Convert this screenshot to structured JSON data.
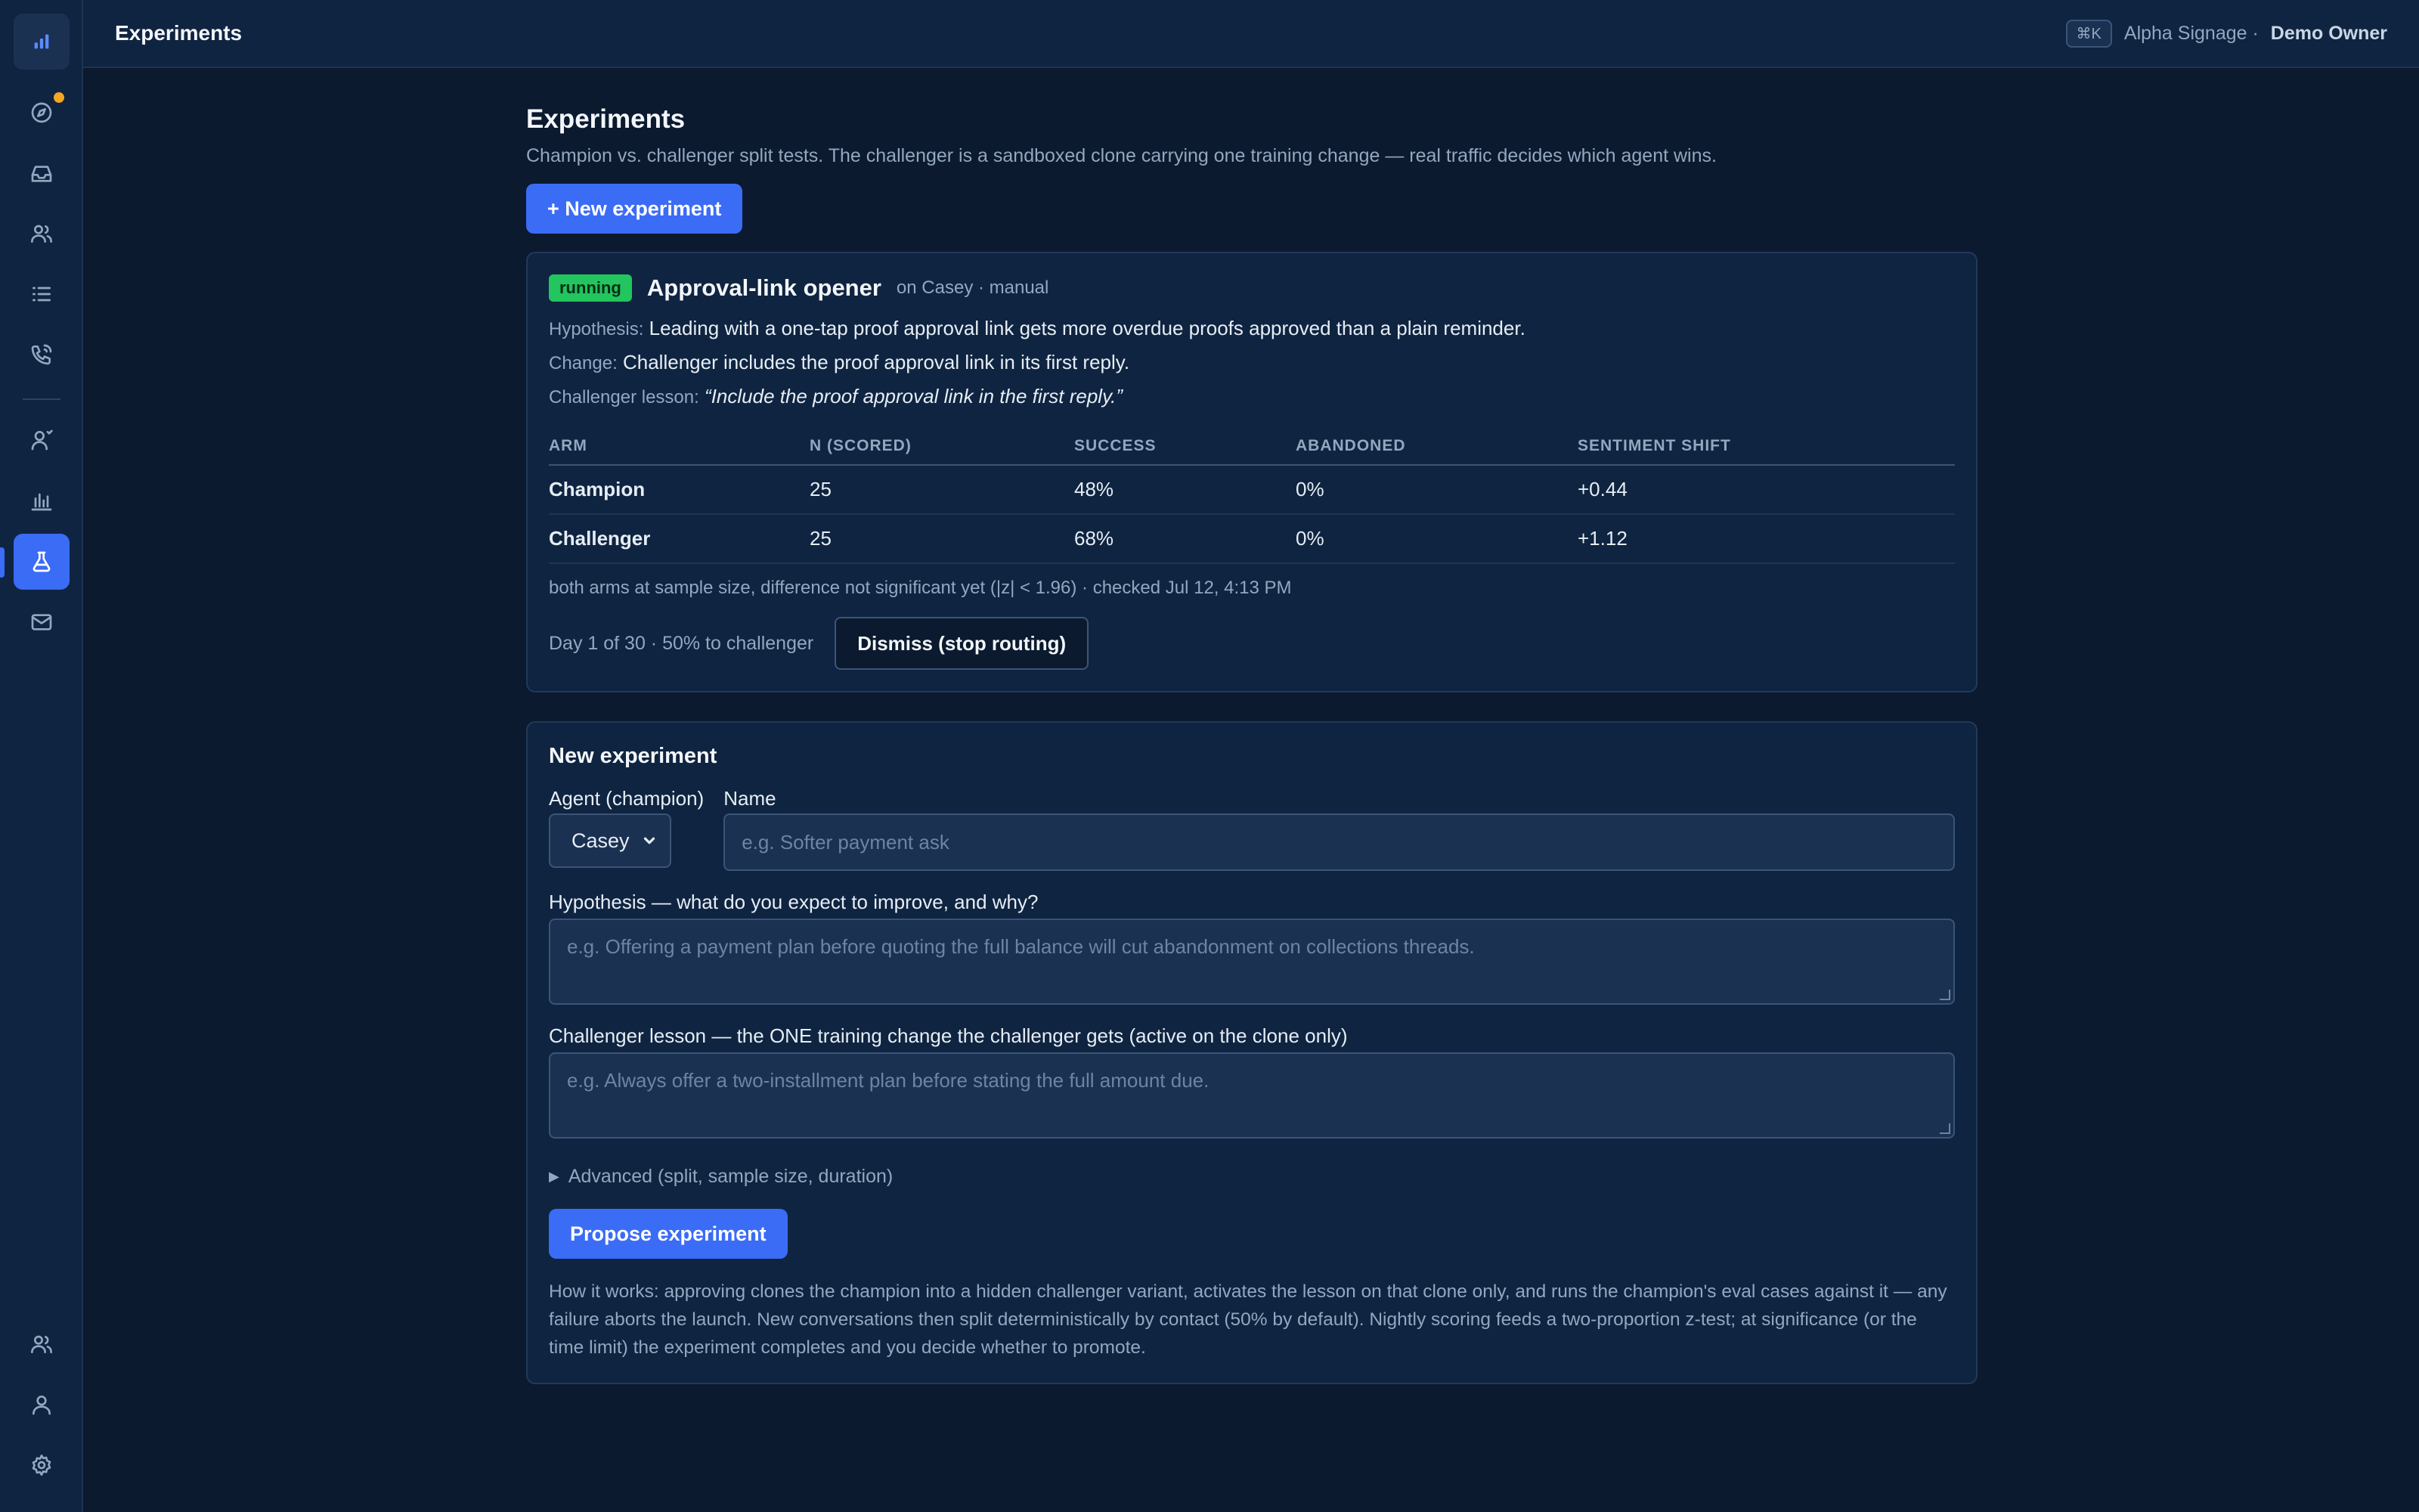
{
  "topbar": {
    "title": "Experiments",
    "shortcut": "⌘K",
    "org": "Alpha Signage ·",
    "user": "Demo Owner"
  },
  "sidebar": {
    "items": [
      {
        "icon": "bar-chart-logo-icon"
      },
      {
        "icon": "compass-icon"
      },
      {
        "icon": "inbox-icon"
      },
      {
        "icon": "contacts-icon"
      },
      {
        "icon": "list-icon"
      },
      {
        "icon": "phone-icon"
      },
      {
        "icon": "agent-icon"
      },
      {
        "icon": "analytics-icon"
      },
      {
        "icon": "flask-icon",
        "active": true
      },
      {
        "icon": "mail-icon"
      },
      {
        "icon": "team-icon"
      },
      {
        "icon": "profile-icon"
      },
      {
        "icon": "gear-icon"
      }
    ],
    "accent": "#3b6cf6",
    "notification_color": "#f5a524"
  },
  "page": {
    "title": "Experiments",
    "subtitle": "Champion vs. challenger split tests. The challenger is a sandboxed clone carrying one training change — real traffic decides which agent wins.",
    "new_button": "+ New experiment"
  },
  "experiment": {
    "status": "running",
    "name": "Approval-link opener",
    "meta": "on Casey · manual",
    "hypothesis_label": "Hypothesis:",
    "hypothesis": "Leading with a one-tap proof approval link gets more overdue proofs approved than a plain reminder.",
    "change_label": "Change:",
    "change": "Challenger includes the proof approval link in its first reply.",
    "lesson_label": "Challenger lesson:",
    "lesson": "“Include the proof approval link in the first reply.”",
    "columns": [
      "ARM",
      "N (SCORED)",
      "SUCCESS",
      "ABANDONED",
      "SENTIMENT SHIFT"
    ],
    "rows": [
      {
        "arm": "Champion",
        "n": "25",
        "success": "48%",
        "abandoned": "0%",
        "sentiment": "+0.44"
      },
      {
        "arm": "Challenger",
        "n": "25",
        "success": "68%",
        "abandoned": "0%",
        "sentiment": "+1.12"
      }
    ],
    "stat_note": "both arms at sample size, difference not significant yet (|z| < 1.96) · checked Jul 12, 4:13 PM",
    "progress": "Day 1 of 30 · 50% to challenger",
    "dismiss_button": "Dismiss (stop routing)"
  },
  "form": {
    "title": "New experiment",
    "agent_label": "Agent (champion)",
    "agent_value": "Casey",
    "name_label": "Name",
    "name_placeholder": "e.g. Softer payment ask",
    "hypothesis_label": "Hypothesis — what do you expect to improve, and why?",
    "hypothesis_placeholder": "e.g. Offering a payment plan before quoting the full balance will cut abandonment on collections threads.",
    "lesson_label": "Challenger lesson — the ONE training change the challenger gets (active on the clone only)",
    "lesson_placeholder": "e.g. Always offer a two-installment plan before stating the full amount due.",
    "advanced": "Advanced (split, sample size, duration)",
    "propose_button": "Propose experiment",
    "how_it_works": "How it works: approving clones the champion into a hidden challenger variant, activates the lesson on that clone only, and runs the champion's eval cases against it — any failure aborts the launch. New conversations then split deterministically by contact (50% by default). Nightly scoring feeds a two-proportion z-test; at significance (or the time limit) the experiment completes and you decide whether to promote."
  }
}
